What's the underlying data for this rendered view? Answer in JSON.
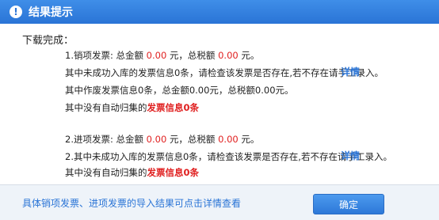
{
  "title": "结果提示",
  "title_icon": "info-icon",
  "heading": "下载完成：",
  "sales": {
    "line1_prefix": "1.销项发票: 总金额",
    "amount": "0.00",
    "line1_mid": "元，总税额",
    "tax": "0.00",
    "line1_suffix": "元。",
    "unrecorded": "其中未成功入库的发票信息0条，请检查该发票是否存在,若不存在请手工录入。",
    "detail_link": "详情",
    "voided": "其中作废发票信息0条，总金额0.00元，总税额0.00元。",
    "not_auto_prefix": "其中没有自动归集的",
    "not_auto_highlight": "发票信息0条"
  },
  "purchase": {
    "line1_prefix": "2.进项发票: 总金额",
    "amount": "0.00",
    "line1_mid": "元，总税额",
    "tax": "0.00",
    "line1_suffix": "元。",
    "unrecorded": "2.其中未成功入库的发票信息0条，请检查该发票是否存在,若不存在请手工录入。",
    "detail_link": "详情",
    "not_auto_prefix": "其中没有自动归集的",
    "not_auto_highlight": "发票信息0条"
  },
  "footer": {
    "note": "具体销项发票、进项发票的导入结果可点击详情查看",
    "ok_label": "确定"
  },
  "colors": {
    "titlebar": "#2a74d6",
    "link": "#2a74d6",
    "highlight": "#e02020",
    "footer_bg": "#eef3f9"
  }
}
